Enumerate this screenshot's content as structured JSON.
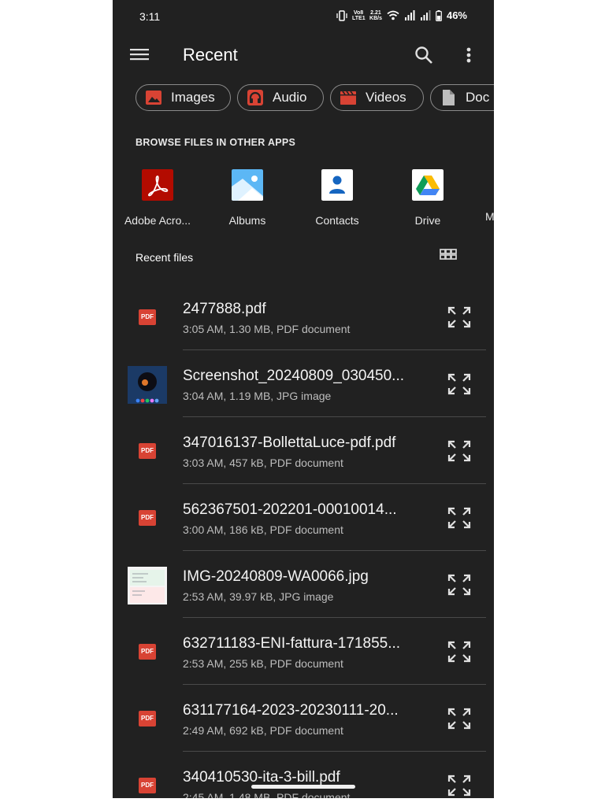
{
  "status_bar": {
    "time": "3:11",
    "volte": "Vo8 LTE1",
    "speed_value": "2.21",
    "speed_unit": "KB/s",
    "battery": "46%"
  },
  "appbar": {
    "title": "Recent"
  },
  "chips": [
    {
      "label": "Images",
      "icon": "image-icon"
    },
    {
      "label": "Audio",
      "icon": "headphones-icon"
    },
    {
      "label": "Videos",
      "icon": "clapperboard-icon"
    },
    {
      "label": "Doc",
      "icon": "document-icon"
    }
  ],
  "browse": {
    "heading": "BROWSE FILES IN OTHER APPS",
    "apps": [
      {
        "label": "Adobe Acro...",
        "icon": "adobe-acrobat-icon"
      },
      {
        "label": "Albums",
        "icon": "albums-icon"
      },
      {
        "label": "Contacts",
        "icon": "contacts-icon"
      },
      {
        "label": "Drive",
        "icon": "google-drive-icon"
      },
      {
        "label": "M",
        "icon": "more-app-icon"
      }
    ]
  },
  "recent": {
    "heading": "Recent files",
    "files": [
      {
        "name": "2477888.pdf",
        "meta": "3:05 AM, 1.30 MB, PDF document",
        "kind": "pdf"
      },
      {
        "name": "Screenshot_20240809_030450...",
        "meta": "3:04 AM, 1.19 MB, JPG image",
        "kind": "image-dark"
      },
      {
        "name": "347016137-BollettaLuce-pdf.pdf",
        "meta": "3:03 AM, 457 kB, PDF document",
        "kind": "pdf"
      },
      {
        "name": "562367501-202201-00010014...",
        "meta": "3:00 AM, 186 kB, PDF document",
        "kind": "pdf"
      },
      {
        "name": "IMG-20240809-WA0066.jpg",
        "meta": "2:53 AM, 39.97 kB, JPG image",
        "kind": "image-light"
      },
      {
        "name": "632711183-ENI-fattura-171855...",
        "meta": "2:53 AM, 255 kB, PDF document",
        "kind": "pdf"
      },
      {
        "name": "631177164-2023-20230111-20...",
        "meta": "2:49 AM, 692 kB, PDF document",
        "kind": "pdf"
      },
      {
        "name": "340410530-ita-3-bill.pdf",
        "meta": "2:45 AM, 1.48 MB, PDF document",
        "kind": "pdf"
      }
    ],
    "pdf_badge": "PDF"
  },
  "colors": {
    "background": "#212121",
    "accent_red": "#d84334",
    "text": "#e8e8e8",
    "muted": "#bdbdbd"
  }
}
